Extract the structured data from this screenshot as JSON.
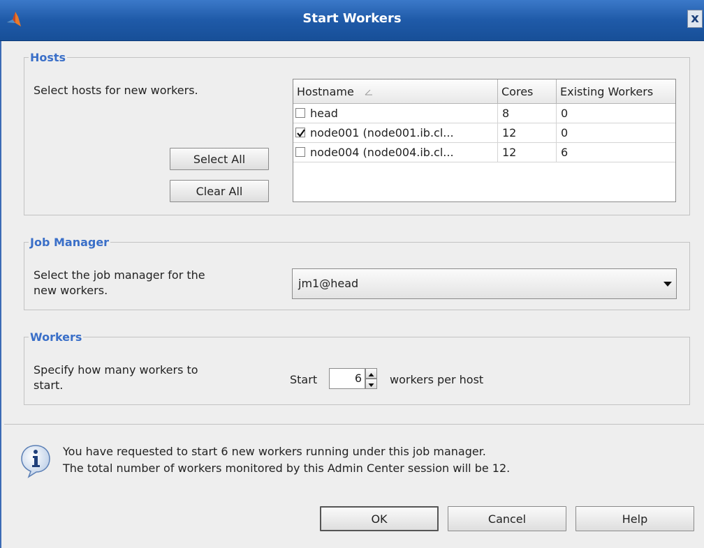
{
  "window": {
    "title": "Start Workers",
    "close_label": "x",
    "accent_color": "#1f5aa8",
    "legend_color": "#3a6fc8"
  },
  "hosts": {
    "legend": "Hosts",
    "description": "Select hosts for new workers.",
    "select_all_label": "Select All",
    "clear_all_label": "Clear All",
    "table": {
      "columns": [
        "Hostname",
        "Cores",
        "Existing Workers"
      ],
      "sort_indicator": "sort-ascending-icon",
      "rows": [
        {
          "checked": false,
          "hostname": "head",
          "cores": "8",
          "existing": "0"
        },
        {
          "checked": true,
          "hostname": "node001 (node001.ib.cl...",
          "cores": "12",
          "existing": "0"
        },
        {
          "checked": false,
          "hostname": "node004 (node004.ib.cl...",
          "cores": "12",
          "existing": "6"
        }
      ]
    }
  },
  "job_manager": {
    "legend": "Job Manager",
    "description_line1": "Select the job manager for the",
    "description_line2": "new workers.",
    "selected": "jm1@head"
  },
  "workers": {
    "legend": "Workers",
    "description_line1": "Specify how many workers to",
    "description_line2": "start.",
    "start_label": "Start",
    "count": "6",
    "suffix_label": "workers per host"
  },
  "info": {
    "icon": "info-icon",
    "line1": "You have requested to start 6 new workers running under this job manager.",
    "line2": "The total number of workers monitored by this Admin Center session will be 12."
  },
  "buttons": {
    "ok": "OK",
    "cancel": "Cancel",
    "help": "Help"
  }
}
